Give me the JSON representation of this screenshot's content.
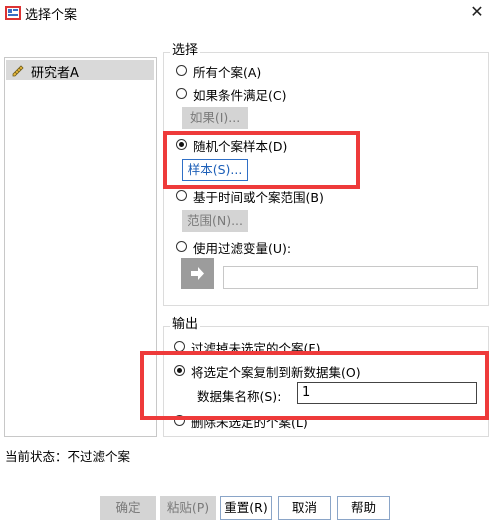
{
  "window": {
    "title": "选择个案",
    "close_glyph": "✕"
  },
  "variables": [
    {
      "label": "研究者A",
      "icon": "pencil-ruler-icon"
    }
  ],
  "select_group": {
    "legend": "选择",
    "all_cases": "所有个案(A)",
    "if_condition": "如果条件满足(C)",
    "if_button": "如果(I)...",
    "random_sample": "随机个案样本(D)",
    "sample_button": "样本(S)...",
    "time_range": "基于时间或个案范围(B)",
    "range_button": "范围(N)...",
    "filter_var": "使用过滤变量(U):",
    "selected": "random_sample"
  },
  "output_group": {
    "legend": "输出",
    "filter_out": "过滤掉未选定的个案(F)",
    "copy_new": "将选定个案复制到新数据集(O)",
    "dataset_name_label": "数据集名称(S):",
    "dataset_name_value": "1",
    "delete_unselected": "删除未选定的个案(L)",
    "selected": "copy_new"
  },
  "status": {
    "text": "当前状态：不过滤个案"
  },
  "buttons": {
    "ok": "确定",
    "paste": "粘贴(P)",
    "reset": "重置(R)",
    "cancel": "取消",
    "help": "帮助"
  },
  "colors": {
    "highlight_box": "#ee3a3a",
    "accent": "#2f6fc6"
  }
}
